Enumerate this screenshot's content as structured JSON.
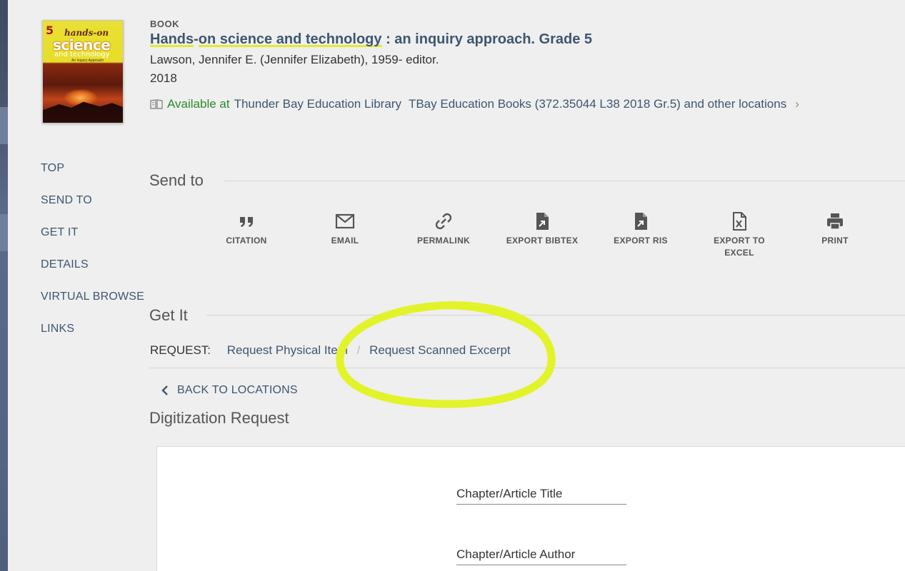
{
  "record": {
    "type_label": "BOOK",
    "title_part1": "Hands",
    "title_part2": "-",
    "title_part3": "on science and technology",
    "title_part4": " : an inquiry approach. Grade 5",
    "author": "Lawson, Jennifer E. (Jennifer Elizabeth), 1959- editor.",
    "year": "2018",
    "availability": {
      "status": "Available at",
      "library": "Thunder Bay Education Library",
      "location": "TBay Education Books (372.35044 L38 2018 Gr.5) and other locations",
      "chevron": "›"
    }
  },
  "cover": {
    "grade": "5",
    "line1": "hands-on",
    "line2": "science",
    "line3": "and technology",
    "line4": "An Inquiry Approach"
  },
  "sidenav": {
    "items": [
      "TOP",
      "SEND TO",
      "GET IT",
      "DETAILS",
      "VIRTUAL BROWSE",
      "LINKS"
    ]
  },
  "send_to": {
    "title": "Send to",
    "actions": [
      {
        "label": "CITATION",
        "icon": "quote-icon"
      },
      {
        "label": "EMAIL",
        "icon": "envelope-icon"
      },
      {
        "label": "PERMALINK",
        "icon": "link-icon"
      },
      {
        "label": "EXPORT BIBTEX",
        "icon": "file-export-icon"
      },
      {
        "label": "EXPORT RIS",
        "icon": "file-export-icon"
      },
      {
        "label": "EXPORT TO EXCEL",
        "icon": "excel-file-icon"
      },
      {
        "label": "PRINT",
        "icon": "printer-icon"
      }
    ]
  },
  "get_it": {
    "title": "Get It",
    "request_label": "REQUEST:",
    "request_physical": "Request Physical Item",
    "separator": "/",
    "request_scanned": "Request Scanned Excerpt",
    "back_label": "BACK TO LOCATIONS"
  },
  "digitization": {
    "title": "Digitization Request",
    "fields": [
      "Chapter/Article Title",
      "Chapter/Article Author"
    ]
  },
  "colors": {
    "link": "#3e5670",
    "available": "#2a8a2a",
    "highlight": "#e3ea30",
    "annotation": "#e2f32a"
  }
}
